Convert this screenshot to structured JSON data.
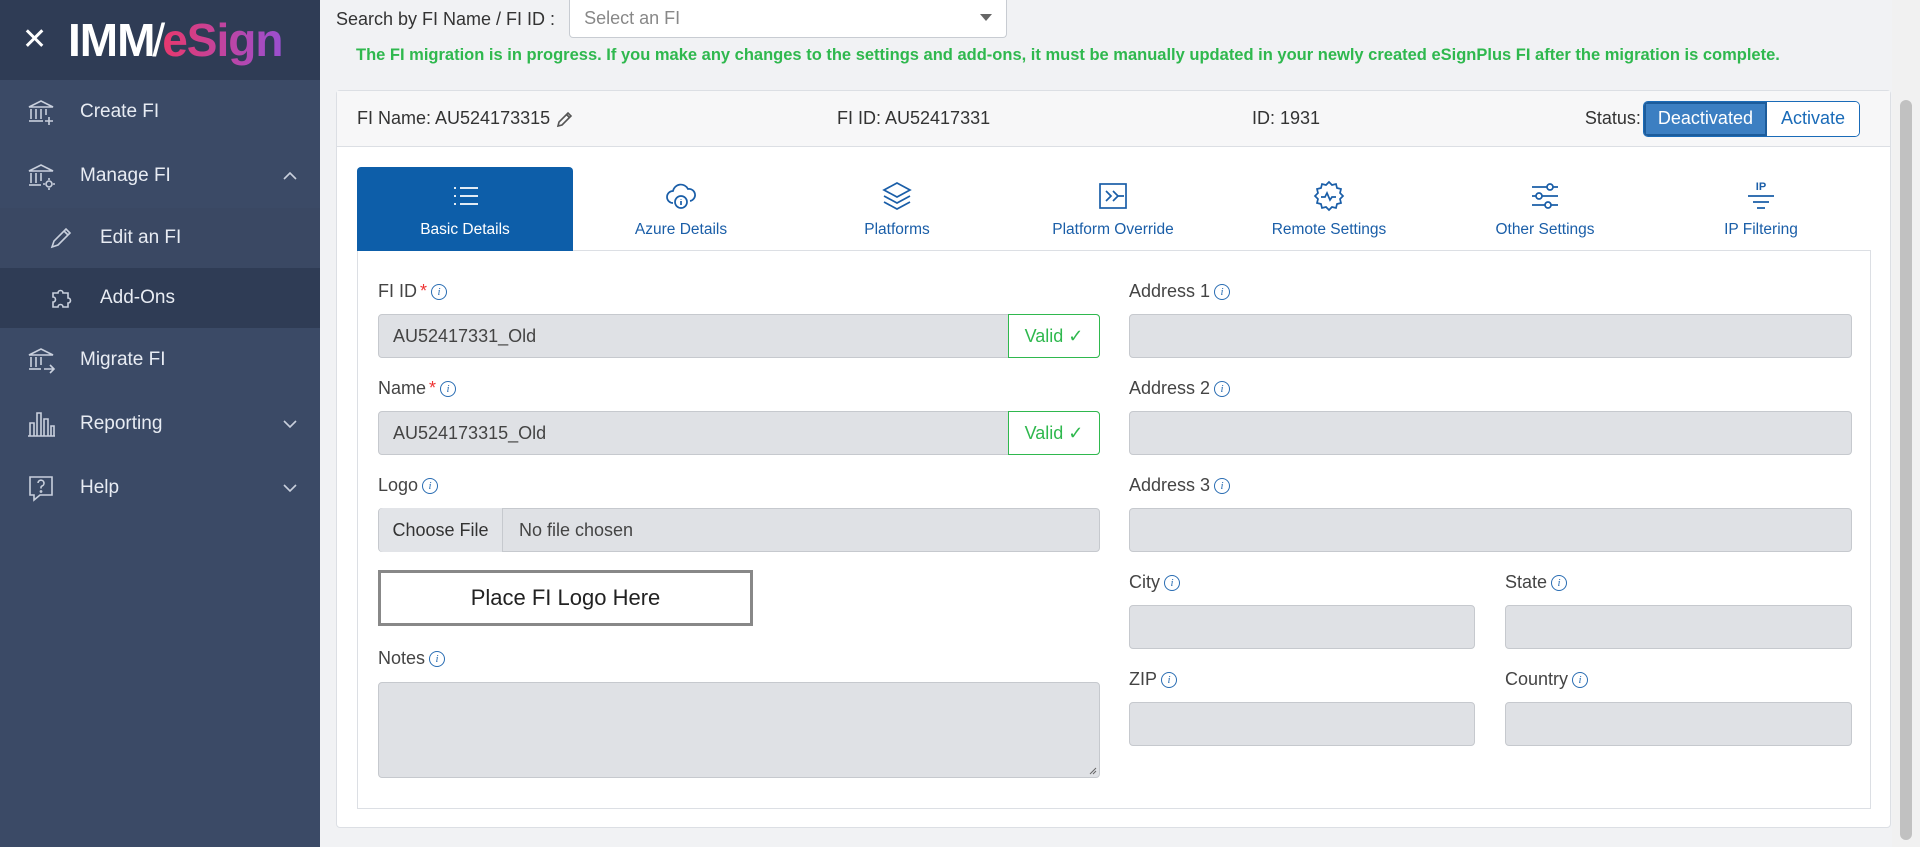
{
  "sidebar": {
    "logo_imm": "IMM",
    "logo_esign": "eSign",
    "items": {
      "create_fi": "Create FI",
      "manage_fi": "Manage FI",
      "edit_fi": "Edit an FI",
      "add_ons": "Add-Ons",
      "migrate_fi": "Migrate FI",
      "reporting": "Reporting",
      "help": "Help"
    }
  },
  "search": {
    "label": "Search by FI Name / FI ID :",
    "placeholder": "Select an FI"
  },
  "banner": "The FI migration is in progress. If you make any changes to the settings and add-ons, it must be manually updated in your newly created eSignPlus FI after the migration is complete.",
  "header": {
    "fi_name": "FI Name: AU524173315",
    "fi_id": "FI ID: AU52417331",
    "id": "ID: 1931",
    "status_label": "Status:",
    "deactivated": "Deactivated",
    "activate": "Activate"
  },
  "tabs": {
    "basic": "Basic Details",
    "azure": "Azure Details",
    "platforms": "Platforms",
    "override": "Platform Override",
    "remote": "Remote Settings",
    "other": "Other Settings",
    "ip": "IP Filtering",
    "ip_icon_text": "IP"
  },
  "form": {
    "fi_id_label": "FI ID",
    "fi_id_value": "AU52417331_Old",
    "name_label": "Name",
    "name_value": "AU524173315_Old",
    "required_mark": "*",
    "valid_text": "Valid ✓",
    "logo_label": "Logo",
    "choose_file": "Choose File",
    "no_file": "No file chosen",
    "logo_placeholder": "Place FI Logo Here",
    "notes_label": "Notes",
    "address1_label": "Address 1",
    "address2_label": "Address 2",
    "address3_label": "Address 3",
    "city_label": "City",
    "state_label": "State",
    "zip_label": "ZIP",
    "country_label": "Country",
    "info_glyph": "i"
  }
}
